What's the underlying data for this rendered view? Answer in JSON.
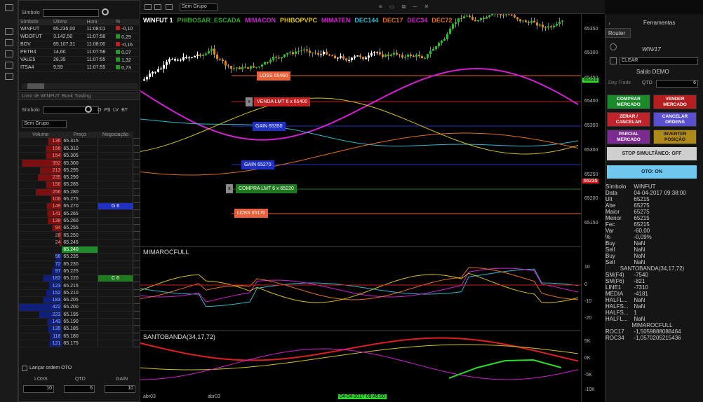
{
  "top_bar": {
    "group_select": "Sem Grupo",
    "window_controls": "≡ ▭ ⧉ ─ ✕"
  },
  "quote_list": {
    "symbol_label": "Símbolo",
    "columns": [
      "Símbolo",
      "Último",
      "Hora",
      "%"
    ],
    "rows": [
      {
        "symbol": "WINFUT",
        "last": "65.235,00",
        "time": "11:08:01",
        "pct": "-0,10",
        "up": false
      },
      {
        "symbol": "WDOFUT",
        "last": "3.142,50",
        "time": "11:07:58",
        "pct": "0,29",
        "up": true
      },
      {
        "symbol": "BOV",
        "last": "65.107,31",
        "time": "11:08:00",
        "pct": "-0,16",
        "up": false
      },
      {
        "symbol": "PETR4",
        "last": "14,60",
        "time": "11:07:58",
        "pct": "0,07",
        "up": true
      },
      {
        "symbol": "VALE5",
        "last": "28,35",
        "time": "11:07:55",
        "pct": "1,32",
        "up": true
      },
      {
        "symbol": "ITSA4",
        "last": "9,59",
        "time": "11:07:55",
        "pct": "0,73",
        "up": true
      }
    ]
  },
  "book": {
    "title": "Livro de WINFUT: Book Trading",
    "symbol_label": "Símbolo",
    "opts": [
      "O",
      "P$",
      "LV",
      "BT"
    ],
    "group": "Sem Grupo",
    "columns": [
      "Volume",
      "Preço",
      "Negociação"
    ],
    "rows": [
      {
        "vol": "136",
        "price": "65.315",
        "neg": "",
        "side": "s"
      },
      {
        "vol": "156",
        "price": "65.310",
        "neg": "",
        "side": "s"
      },
      {
        "vol": "154",
        "price": "65.305",
        "neg": "",
        "side": "s"
      },
      {
        "vol": "392",
        "price": "65.300",
        "neg": "",
        "side": "s"
      },
      {
        "vol": "213",
        "price": "65.295",
        "neg": "",
        "side": "s"
      },
      {
        "vol": "235",
        "price": "65.290",
        "neg": "",
        "side": "s"
      },
      {
        "vol": "156",
        "price": "65.285",
        "neg": "",
        "side": "s"
      },
      {
        "vol": "256",
        "price": "65.280",
        "neg": "",
        "side": "s"
      },
      {
        "vol": "106",
        "price": "65.275",
        "neg": "",
        "side": "s"
      },
      {
        "vol": "149",
        "price": "65.270",
        "neg": "G 6",
        "side": "s"
      },
      {
        "vol": "141",
        "price": "65.265",
        "neg": "",
        "side": "s"
      },
      {
        "vol": "138",
        "price": "65.260",
        "neg": "",
        "side": "s"
      },
      {
        "vol": "94",
        "price": "65.255",
        "neg": "",
        "side": "s"
      },
      {
        "vol": "28",
        "price": "65.250",
        "neg": "",
        "side": "s"
      },
      {
        "vol": "24",
        "price": "65.245",
        "neg": "",
        "side": "s"
      },
      {
        "vol": "",
        "price": "65.240",
        "neg": "",
        "side": "last"
      },
      {
        "vol": "58",
        "price": "65.235",
        "neg": "",
        "side": "b"
      },
      {
        "vol": "72",
        "price": "65.230",
        "neg": "",
        "side": "b"
      },
      {
        "vol": "97",
        "price": "65.225",
        "neg": "",
        "side": "b"
      },
      {
        "vol": "182",
        "price": "65.220",
        "neg": "C 6",
        "side": "b"
      },
      {
        "vol": "123",
        "price": "65.215",
        "neg": "",
        "side": "b"
      },
      {
        "vol": "152",
        "price": "65.210",
        "neg": "",
        "side": "b"
      },
      {
        "vol": "183",
        "price": "65.205",
        "neg": "",
        "side": "b"
      },
      {
        "vol": "422",
        "price": "65.200",
        "neg": "",
        "side": "b"
      },
      {
        "vol": "223",
        "price": "65.195",
        "neg": "",
        "side": "b"
      },
      {
        "vol": "143",
        "price": "65.190",
        "neg": "",
        "side": "b"
      },
      {
        "vol": "135",
        "price": "65.185",
        "neg": "",
        "side": "b"
      },
      {
        "vol": "118",
        "price": "65.180",
        "neg": "",
        "side": "b"
      },
      {
        "vol": "121",
        "price": "65.175",
        "neg": "",
        "side": "b"
      }
    ],
    "launch_label": "Lançar ordem OTO",
    "loss_label": "LOSS",
    "qtd_label": "QTD",
    "gain_label": "GAIN",
    "loss_value": "10",
    "qtd_value": "6",
    "gain_value": "10"
  },
  "chart": {
    "indicators": [
      {
        "name": "WINFUT 1",
        "color": "#ffffff"
      },
      {
        "name": "PHIBOSAR_ESCADA",
        "color": "#2ea82e"
      },
      {
        "name": "MIMACON",
        "color": "#d020d0"
      },
      {
        "name": "PHIBOPVPC",
        "color": "#d6c11e"
      },
      {
        "name": "MIMATEN",
        "color": "#d020d0"
      },
      {
        "name": "DEC144",
        "color": "#2fb9d0"
      },
      {
        "name": "DEC17",
        "color": "#e07020"
      },
      {
        "name": "DEC34",
        "color": "#d020d0"
      },
      {
        "name": "DEC72",
        "color": "#e07020"
      }
    ],
    "price_ticks": [
      "65350",
      "65300",
      "65450",
      "65400",
      "65350",
      "65300",
      "65250",
      "65200",
      "65150"
    ],
    "last_price": "65235",
    "green_marker": "65440",
    "orders": [
      {
        "label": "LOSS 65460",
        "color": "#e8603a"
      },
      {
        "label": "VENDA LMT 6 x 65400",
        "color": "#c02020"
      },
      {
        "label": "GAIN 65350",
        "color": "#2030c0"
      },
      {
        "label": "GAIN 65270",
        "color": "#2030c0"
      },
      {
        "label": "COMPRA LMT 6 x 65220",
        "color": "#1f7a1f"
      },
      {
        "label": "LOSS 65170",
        "color": "#e8603a"
      }
    ],
    "osc_title": "MIMAROCFULL",
    "osc_ticks": [
      "10",
      "0",
      "-10",
      "-20"
    ],
    "santo_title": "SANTOBANDA(34,17,72)",
    "santo_ticks": [
      "5K",
      "0K",
      "-5K",
      "-10K"
    ],
    "time_labels": [
      "abr03",
      "abr03"
    ],
    "crosshair_time": "04-04-2017 09:45:00"
  },
  "right_panel": {
    "title": "Ferramentas",
    "tab": "Router",
    "symbol": "WIN/17",
    "broker": "CLEAR",
    "balance": "Saldo DEMO",
    "daytrade": "Day Trade",
    "qtd_label": "QTD",
    "qtd_value": "6",
    "buttons": [
      {
        "label": "COMPRAR MERCADO",
        "bg": "#1c8a2a",
        "fg": "#fff"
      },
      {
        "label": "VENDER MERCADO",
        "bg": "#b51e1e",
        "fg": "#fff"
      },
      {
        "label": "ZERAR / CANCELAR",
        "bg": "#c0232a",
        "fg": "#fff"
      },
      {
        "label": "CANCELAR ORDENS",
        "bg": "#5a4fd1",
        "fg": "#fff"
      },
      {
        "label": "PARCIAL MERCADO",
        "bg": "#7b2b8f",
        "fg": "#fff"
      },
      {
        "label": "INVERTER POSIÇÃO",
        "bg": "#b08a18",
        "fg": "#111"
      }
    ],
    "stop_btn": "STOP SIMULTÂNEO: OFF",
    "oto_btn": "OTO: ON",
    "stats": [
      [
        "Símbolo",
        "WINFUT"
      ],
      [
        "Data",
        "04-04-2017 09:38:00"
      ],
      [
        "Ult",
        "65215"
      ],
      [
        "Abe",
        "65275"
      ],
      [
        "Maior",
        "65275"
      ],
      [
        "Menor",
        "65215"
      ],
      [
        "Fec",
        "65215"
      ],
      [
        "Var",
        "-60,00"
      ],
      [
        "%",
        "-0,09%"
      ],
      [
        "Buy",
        "NaN"
      ],
      [
        "Sell",
        "NaN"
      ],
      [
        "Buy",
        "NaN"
      ],
      [
        "Sell",
        "NaN"
      ],
      [
        "SANTOBANDA(34,17,72)",
        ""
      ],
      [
        "SM(F4)",
        "-7540"
      ],
      [
        "SM(F6)",
        "-821"
      ],
      [
        "LINE1",
        "-7310"
      ],
      [
        "MÉDIA",
        "-4181"
      ],
      [
        "HALFL...",
        "NaN"
      ],
      [
        "HALFS...",
        "NaN"
      ],
      [
        "HALFS...",
        "1"
      ],
      [
        "HALFL...",
        "NaN"
      ],
      [
        "MIMAROCFULL",
        ""
      ],
      [
        "ROC17",
        "-1,5059888088464"
      ],
      [
        "ROC34",
        "-1,0570205215436"
      ]
    ]
  }
}
